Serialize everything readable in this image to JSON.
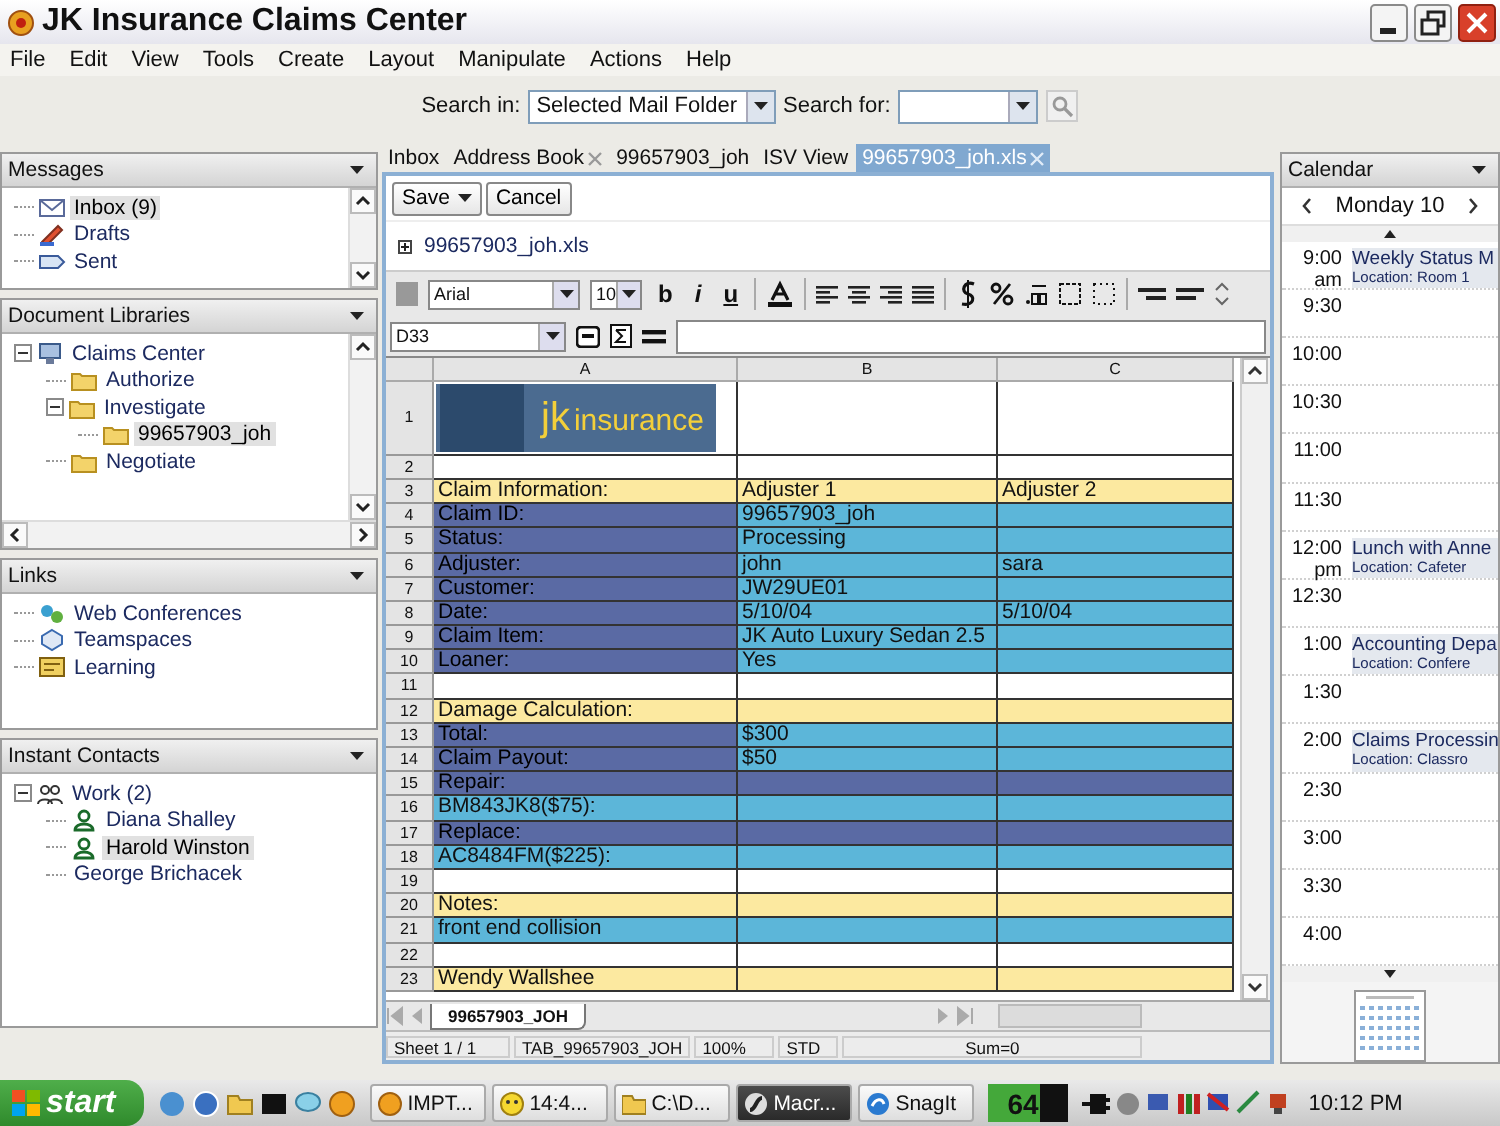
{
  "window": {
    "title": "JK Insurance Claims Center"
  },
  "menu": [
    "File",
    "Edit",
    "View",
    "Tools",
    "Create",
    "Layout",
    "Manipulate",
    "Actions",
    "Help"
  ],
  "search": {
    "scope_label": "Search in:",
    "scope": "Selected Mail Folder",
    "query_label": "Search for:"
  },
  "sidebar": {
    "panels": [
      {
        "title": "Messages",
        "kind": "scrolled",
        "items": [
          {
            "label": "Inbox (9)",
            "kind": "mail",
            "selected": true
          },
          {
            "label": "Drafts",
            "kind": "draft",
            "selected": false
          },
          {
            "label": "Sent",
            "kind": "sent",
            "selected": false
          }
        ]
      },
      {
        "title": "Document Libraries",
        "kind": "scrolled",
        "items": [
          {
            "label": "Claims Center",
            "kind": "library",
            "selected": false,
            "expanded": true,
            "children": [
              {
                "label": "Authorize",
                "kind": "folder",
                "selected": false
              },
              {
                "label": "Investigate",
                "kind": "folder",
                "selected": false,
                "expanded": true,
                "children": [
                  {
                    "label": "99657903_joh",
                    "kind": "folder",
                    "selected": true
                  }
                ]
              },
              {
                "label": "Negotiate",
                "kind": "folder",
                "selected": false
              }
            ]
          }
        ]
      },
      {
        "title": "Links",
        "kind": "plain",
        "items": [
          {
            "label": "Web Conferences",
            "kind": "conference",
            "selected": false
          },
          {
            "label": "Teamspaces",
            "kind": "teamspace",
            "selected": false
          },
          {
            "label": "Learning",
            "kind": "learning",
            "selected": false
          }
        ]
      },
      {
        "title": "Instant Contacts",
        "kind": "plain",
        "items": [
          {
            "label": "Work (2)",
            "kind": "group",
            "selected": false,
            "expanded": true,
            "children": [
              {
                "label": "Diana Shalley",
                "kind": "person",
                "selected": false
              },
              {
                "label": "Harold Winston",
                "kind": "person",
                "selected": true
              },
              {
                "label": "George Brichacek",
                "kind": "none",
                "selected": false
              }
            ]
          }
        ]
      }
    ]
  },
  "tabs": [
    {
      "label": "Inbox",
      "selected": false,
      "closable": false
    },
    {
      "label": "Address Book",
      "selected": false,
      "closable": true
    },
    {
      "label": "99657903_joh",
      "selected": false,
      "closable": false
    },
    {
      "label": "ISV View",
      "selected": false,
      "closable": false
    },
    {
      "label": "99657903_joh.xls",
      "selected": true,
      "closable": true
    }
  ],
  "document": {
    "buttons": [
      {
        "label": "Save",
        "kind": "menu"
      },
      {
        "label": "Cancel",
        "kind": "plain"
      }
    ],
    "file": "99657903_joh.xls",
    "font": "Arial",
    "size": "10",
    "format_buttons": [
      "b",
      "i",
      "u"
    ],
    "cell_ref": "D33"
  },
  "sheet": {
    "columns": [
      "A",
      "B",
      "C"
    ],
    "logo": {
      "row": "1",
      "brand": "jk",
      "word": "insurance"
    },
    "rows": [
      {
        "num": "2",
        "cells": [
          {
            "kind": "blank"
          },
          {
            "kind": "blank"
          },
          {
            "kind": "blank"
          }
        ]
      },
      {
        "num": "3",
        "cells": [
          {
            "kind": "header",
            "text": "Claim Information:"
          },
          {
            "kind": "header",
            "text": "Adjuster 1"
          },
          {
            "kind": "header",
            "text": "Adjuster 2"
          }
        ]
      },
      {
        "num": "4",
        "cells": [
          {
            "kind": "label",
            "text": "Claim ID:"
          },
          {
            "kind": "value",
            "text": "99657903_joh"
          },
          {
            "kind": "value"
          }
        ]
      },
      {
        "num": "5",
        "cells": [
          {
            "kind": "label",
            "text": "Status:"
          },
          {
            "kind": "value",
            "text": "Processing"
          },
          {
            "kind": "value"
          }
        ]
      },
      {
        "num": "6",
        "cells": [
          {
            "kind": "label",
            "text": "Adjuster:"
          },
          {
            "kind": "value",
            "text": "john"
          },
          {
            "kind": "value",
            "text": "sara"
          }
        ]
      },
      {
        "num": "7",
        "cells": [
          {
            "kind": "label",
            "text": "Customer:"
          },
          {
            "kind": "value",
            "text": "JW29UE01"
          },
          {
            "kind": "value"
          }
        ]
      },
      {
        "num": "8",
        "cells": [
          {
            "kind": "label",
            "text": "Date:"
          },
          {
            "kind": "value",
            "text": "5/10/04"
          },
          {
            "kind": "value",
            "text": "5/10/04"
          }
        ]
      },
      {
        "num": "9",
        "cells": [
          {
            "kind": "label",
            "text": "Claim Item:"
          },
          {
            "kind": "value",
            "text": "JK Auto Luxury Sedan 2.5"
          },
          {
            "kind": "value"
          }
        ]
      },
      {
        "num": "10",
        "cells": [
          {
            "kind": "label",
            "text": "Loaner:"
          },
          {
            "kind": "value",
            "text": "Yes"
          },
          {
            "kind": "value"
          }
        ]
      },
      {
        "num": "11",
        "cells": [
          {
            "kind": "blank"
          },
          {
            "kind": "blank"
          },
          {
            "kind": "blank"
          }
        ]
      },
      {
        "num": "12",
        "cells": [
          {
            "kind": "header",
            "text": "Damage Calculation:"
          },
          {
            "kind": "header"
          },
          {
            "kind": "header"
          }
        ]
      },
      {
        "num": "13",
        "cells": [
          {
            "kind": "label",
            "text": "Total:"
          },
          {
            "kind": "value",
            "text": "$300"
          },
          {
            "kind": "value"
          }
        ]
      },
      {
        "num": "14",
        "cells": [
          {
            "kind": "label",
            "text": "Claim Payout:"
          },
          {
            "kind": "value",
            "text": "$50"
          },
          {
            "kind": "value"
          }
        ]
      },
      {
        "num": "15",
        "cells": [
          {
            "kind": "label",
            "text": "Repair:"
          },
          {
            "kind": "label"
          },
          {
            "kind": "label"
          }
        ]
      },
      {
        "num": "16",
        "cells": [
          {
            "kind": "value",
            "text": "BM843JK8($75):"
          },
          {
            "kind": "value"
          },
          {
            "kind": "value"
          }
        ]
      },
      {
        "num": "17",
        "cells": [
          {
            "kind": "label",
            "text": "Replace:"
          },
          {
            "kind": "label"
          },
          {
            "kind": "label"
          }
        ]
      },
      {
        "num": "18",
        "cells": [
          {
            "kind": "value",
            "text": "AC8484FM($225):"
          },
          {
            "kind": "value"
          },
          {
            "kind": "value"
          }
        ]
      },
      {
        "num": "19",
        "cells": [
          {
            "kind": "blank"
          },
          {
            "kind": "blank"
          },
          {
            "kind": "blank"
          }
        ]
      },
      {
        "num": "20",
        "cells": [
          {
            "kind": "header",
            "text": "Notes:"
          },
          {
            "kind": "header"
          },
          {
            "kind": "header"
          }
        ]
      },
      {
        "num": "21",
        "cells": [
          {
            "kind": "value",
            "text": "front end collision"
          },
          {
            "kind": "value"
          },
          {
            "kind": "value"
          }
        ]
      },
      {
        "num": "22",
        "cells": [
          {
            "kind": "blank"
          },
          {
            "kind": "blank"
          },
          {
            "kind": "blank"
          }
        ]
      },
      {
        "num": "23",
        "cells": [
          {
            "kind": "header",
            "text": "Wendy Wallshee"
          },
          {
            "kind": "header"
          },
          {
            "kind": "header"
          }
        ]
      }
    ],
    "sheet_tab": "99657903_JOH",
    "status": [
      "Sheet 1 / 1",
      "TAB_99657903_JOH",
      "100%",
      "STD",
      "Sum=0"
    ]
  },
  "calendar": {
    "title": "Calendar",
    "day": "Monday 10",
    "slots": [
      {
        "time": "9:00",
        "meridiem": "am",
        "event": {
          "title": "Weekly Status M",
          "location": "Location: Room 1"
        }
      },
      {
        "time": "9:30"
      },
      {
        "time": "10:00"
      },
      {
        "time": "10:30"
      },
      {
        "time": "11:00"
      },
      {
        "time": "11:30"
      },
      {
        "time": "12:00",
        "meridiem": "pm",
        "event": {
          "title": "Lunch with Anne",
          "location": "Location: Cafeter"
        }
      },
      {
        "time": "12:30"
      },
      {
        "time": "1:00",
        "event": {
          "title": "Accounting Depa",
          "location": "Location: Confere"
        }
      },
      {
        "time": "1:30"
      },
      {
        "time": "2:00",
        "event": {
          "title": "Claims Processin",
          "location": "Location: Classro"
        }
      },
      {
        "time": "2:30"
      },
      {
        "time": "3:00"
      },
      {
        "time": "3:30"
      },
      {
        "time": "4:00"
      }
    ]
  },
  "taskbar": {
    "start": "start",
    "tasks": [
      {
        "label": "IMPT...",
        "kind": "coin",
        "selected": false
      },
      {
        "label": "14:4...",
        "kind": "smiley",
        "selected": false
      },
      {
        "label": "C:\\D...",
        "kind": "folder",
        "selected": false
      },
      {
        "label": "Macr...",
        "kind": "flash",
        "selected": true
      },
      {
        "label": "SnagIt",
        "kind": "snag",
        "selected": false
      }
    ],
    "meter": "64",
    "clock": "10:12 PM"
  }
}
